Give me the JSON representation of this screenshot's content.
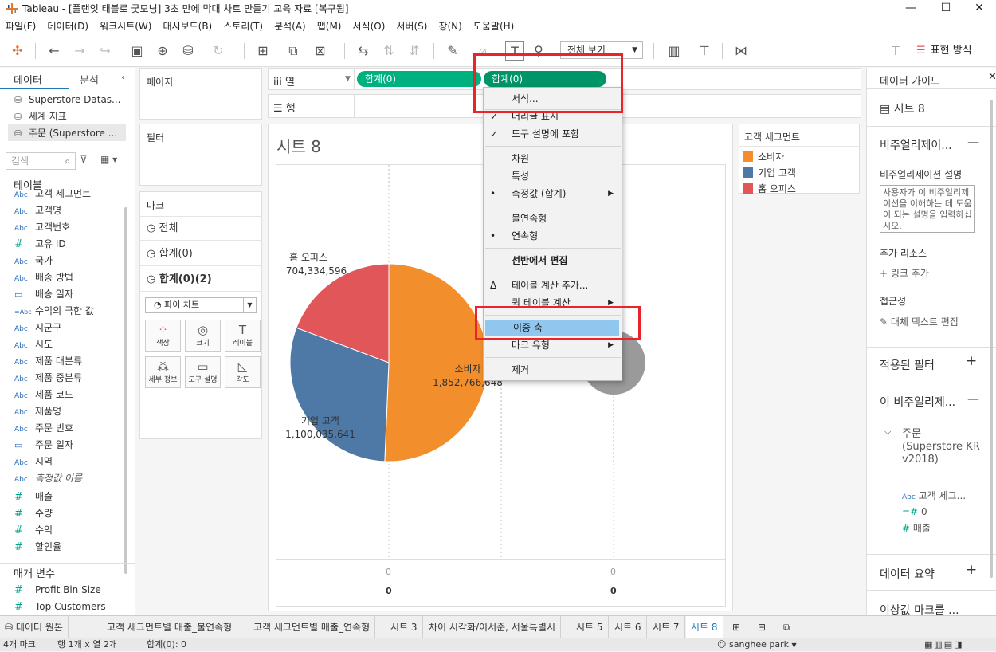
{
  "window": {
    "title": "Tableau - [플랜잇 태블로 굿모닝] 3초 만에 막대 차트 만들기 교육 자료 [복구됨]",
    "minimize": "—",
    "maximize": "☐",
    "close": "✕"
  },
  "menu": [
    "파일(F)",
    "데이터(D)",
    "워크시트(W)",
    "대시보드(B)",
    "스토리(T)",
    "분석(A)",
    "맵(M)",
    "서식(O)",
    "서버(S)",
    "창(N)",
    "도움말(H)"
  ],
  "toolbar": {
    "view_select": "전체 보기",
    "present": "표현 방식"
  },
  "left": {
    "tab_data": "데이터",
    "tab_analysis": "분석",
    "datasources": [
      "Superstore Datas...",
      "세계 지표",
      "주문 (Superstore ..."
    ],
    "search_placeholder": "검색",
    "tables_title": "테이블",
    "fields": [
      {
        "type": "Abc",
        "name": "고객 세그먼트"
      },
      {
        "type": "Abc",
        "name": "고객명"
      },
      {
        "type": "Abc",
        "name": "고객번호"
      },
      {
        "type": "#",
        "name": "고유 ID"
      },
      {
        "type": "Abc",
        "name": "국가"
      },
      {
        "type": "Abc",
        "name": "배송 방법"
      },
      {
        "type": "date",
        "name": "배송 일자"
      },
      {
        "type": "=Abc",
        "name": "수익의 극한 값"
      },
      {
        "type": "Abc",
        "name": "시군구"
      },
      {
        "type": "Abc",
        "name": "시도"
      },
      {
        "type": "Abc",
        "name": "제품 대분류"
      },
      {
        "type": "Abc",
        "name": "제품 중분류"
      },
      {
        "type": "Abc",
        "name": "제품 코드"
      },
      {
        "type": "Abc",
        "name": "제품명"
      },
      {
        "type": "Abc",
        "name": "주문 번호"
      },
      {
        "type": "date",
        "name": "주문 일자"
      },
      {
        "type": "Abc",
        "name": "지역"
      },
      {
        "type": "Abc",
        "name": "측정값 이름"
      },
      {
        "type": "#",
        "name": "매출"
      },
      {
        "type": "#",
        "name": "수량"
      },
      {
        "type": "#",
        "name": "수익"
      },
      {
        "type": "#",
        "name": "할인율"
      }
    ],
    "params_title": "매개 변수",
    "params": [
      {
        "type": "#",
        "name": "Profit Bin Size"
      },
      {
        "type": "#",
        "name": "Top Customers"
      }
    ]
  },
  "cards": {
    "pages": "페이지",
    "filters": "필터",
    "marks": "마크",
    "mark_rows": [
      "전체",
      "합계(0)",
      "합계(0)(2)"
    ],
    "mark_type": "파이 차트",
    "mark_buttons": [
      "색상",
      "크기",
      "레이블",
      "세부 정보",
      "도구 설명",
      "각도"
    ]
  },
  "shelves": {
    "columns_label": "열",
    "rows_label": "행",
    "pill1": "합계(0)",
    "pill2": "합계(0)"
  },
  "sheet": {
    "title": "시트 8",
    "axis_ticks": [
      "0",
      "0"
    ],
    "axis_values": [
      "0",
      "0"
    ]
  },
  "chart_data": {
    "type": "pie",
    "categories": [
      "소비자",
      "기업 고객",
      "홈 오피스"
    ],
    "values": [
      1852766648,
      1100035641,
      704334596
    ],
    "value_labels": [
      "1,852,766,648",
      "1,100,035,641",
      "704,334,596"
    ],
    "colors": [
      "#f28e2b",
      "#4e79a7",
      "#e15759"
    ],
    "second_mark_color": "#9a9a9a"
  },
  "legend": {
    "title": "고객 세그먼트",
    "items": [
      "소비자",
      "기업 고객",
      "홈 오피스"
    ]
  },
  "context_menu": {
    "items": [
      {
        "label": "서식...",
        "check": "",
        "arrow": false,
        "bold": false
      },
      {
        "label": "머리글 표시",
        "check": "✓",
        "arrow": false,
        "bold": false
      },
      {
        "label": "도구 설명에 포함",
        "check": "✓",
        "arrow": false,
        "bold": false
      },
      {
        "label": "차원",
        "check": "",
        "arrow": false,
        "bold": false
      },
      {
        "label": "특성",
        "check": "",
        "arrow": false,
        "bold": false
      },
      {
        "label": "측정값 (합계)",
        "check": "•",
        "arrow": true,
        "bold": false
      },
      {
        "label": "불연속형",
        "check": "",
        "arrow": false,
        "bold": false
      },
      {
        "label": "연속형",
        "check": "•",
        "arrow": false,
        "bold": false
      },
      {
        "label": "선반에서 편집",
        "check": "",
        "arrow": false,
        "bold": true
      },
      {
        "label": "테이블 계산 추가...",
        "check": "Δ",
        "arrow": false,
        "bold": false
      },
      {
        "label": "퀵 테이블 계산",
        "check": "",
        "arrow": true,
        "bold": false
      },
      {
        "label": "이중 축",
        "check": "",
        "arrow": false,
        "bold": false
      },
      {
        "label": "마크 유형",
        "check": "",
        "arrow": true,
        "bold": false
      },
      {
        "label": "제거",
        "check": "",
        "arrow": false,
        "bold": false
      }
    ]
  },
  "right": {
    "tab": "데이터 가이드",
    "sheet_name": "시트 8",
    "viz_section": "비주얼리제이...",
    "viz_desc_label": "비주얼리제이션 설명",
    "viz_desc_placeholder": "사용자가 이 비주얼리제이션을 이해하는 데 도움이 되는 설명을 입력하십시오.",
    "resources_label": "추가 리소스",
    "add_link": "링크 추가",
    "accessibility_label": "접근성",
    "alt_text": "대체 텍스트 편집",
    "applied_filters": "적용된 필터",
    "this_viz": "이 비주얼리제...",
    "source_name": "주문 (Superstore KR v2018)",
    "source_fields": [
      "고객 세그...",
      "0",
      "매출"
    ],
    "data_summary": "데이터 요약",
    "outlier": "이상값 마크를 ..."
  },
  "bottom_tabs": [
    "데이터 원본",
    "고객 세그먼트별 매출_불연속형",
    "고객 세그먼트별 매출_연속형",
    "시트 3",
    "차이 시각화/이서준, 서울특별시",
    "시트 5",
    "시트 6",
    "시트 7",
    "시트 8"
  ],
  "status": {
    "marks": "4개 마크",
    "rows_cols": "행 1개 x 열 2개",
    "sum": "합계(0): 0",
    "user": "sanghee park"
  }
}
